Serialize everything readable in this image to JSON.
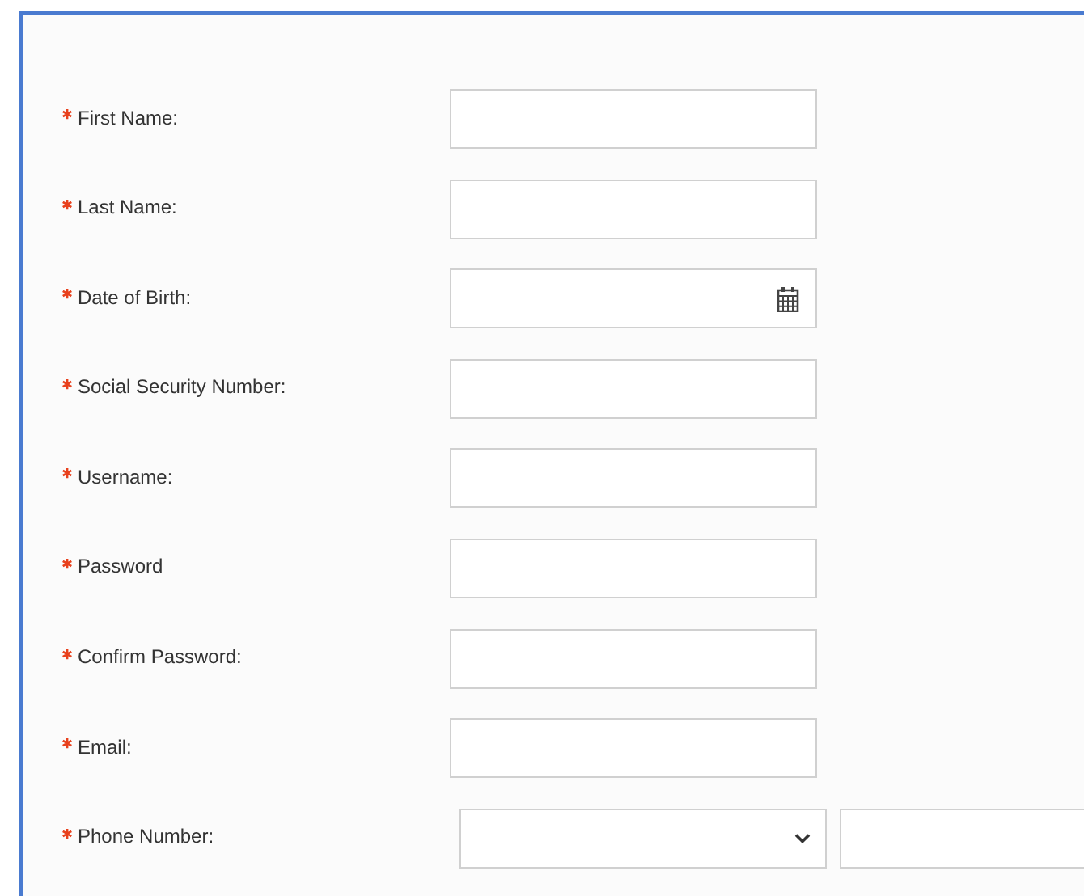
{
  "form": {
    "fields": [
      {
        "kind": "text",
        "label": "First Name:",
        "required": true
      },
      {
        "kind": "text",
        "label": "Last Name:",
        "required": true
      },
      {
        "kind": "date",
        "label": "Date of Birth:",
        "required": true
      },
      {
        "kind": "text",
        "label": "Social Security Number:",
        "required": true
      },
      {
        "kind": "text",
        "label": "Username:",
        "required": true
      },
      {
        "kind": "password",
        "label": "Password",
        "required": true
      },
      {
        "kind": "password",
        "label": "Confirm Password:",
        "required": true
      },
      {
        "kind": "text",
        "label": "Email:",
        "required": true
      },
      {
        "kind": "phone",
        "label": "Phone Number:",
        "required": true
      }
    ]
  }
}
